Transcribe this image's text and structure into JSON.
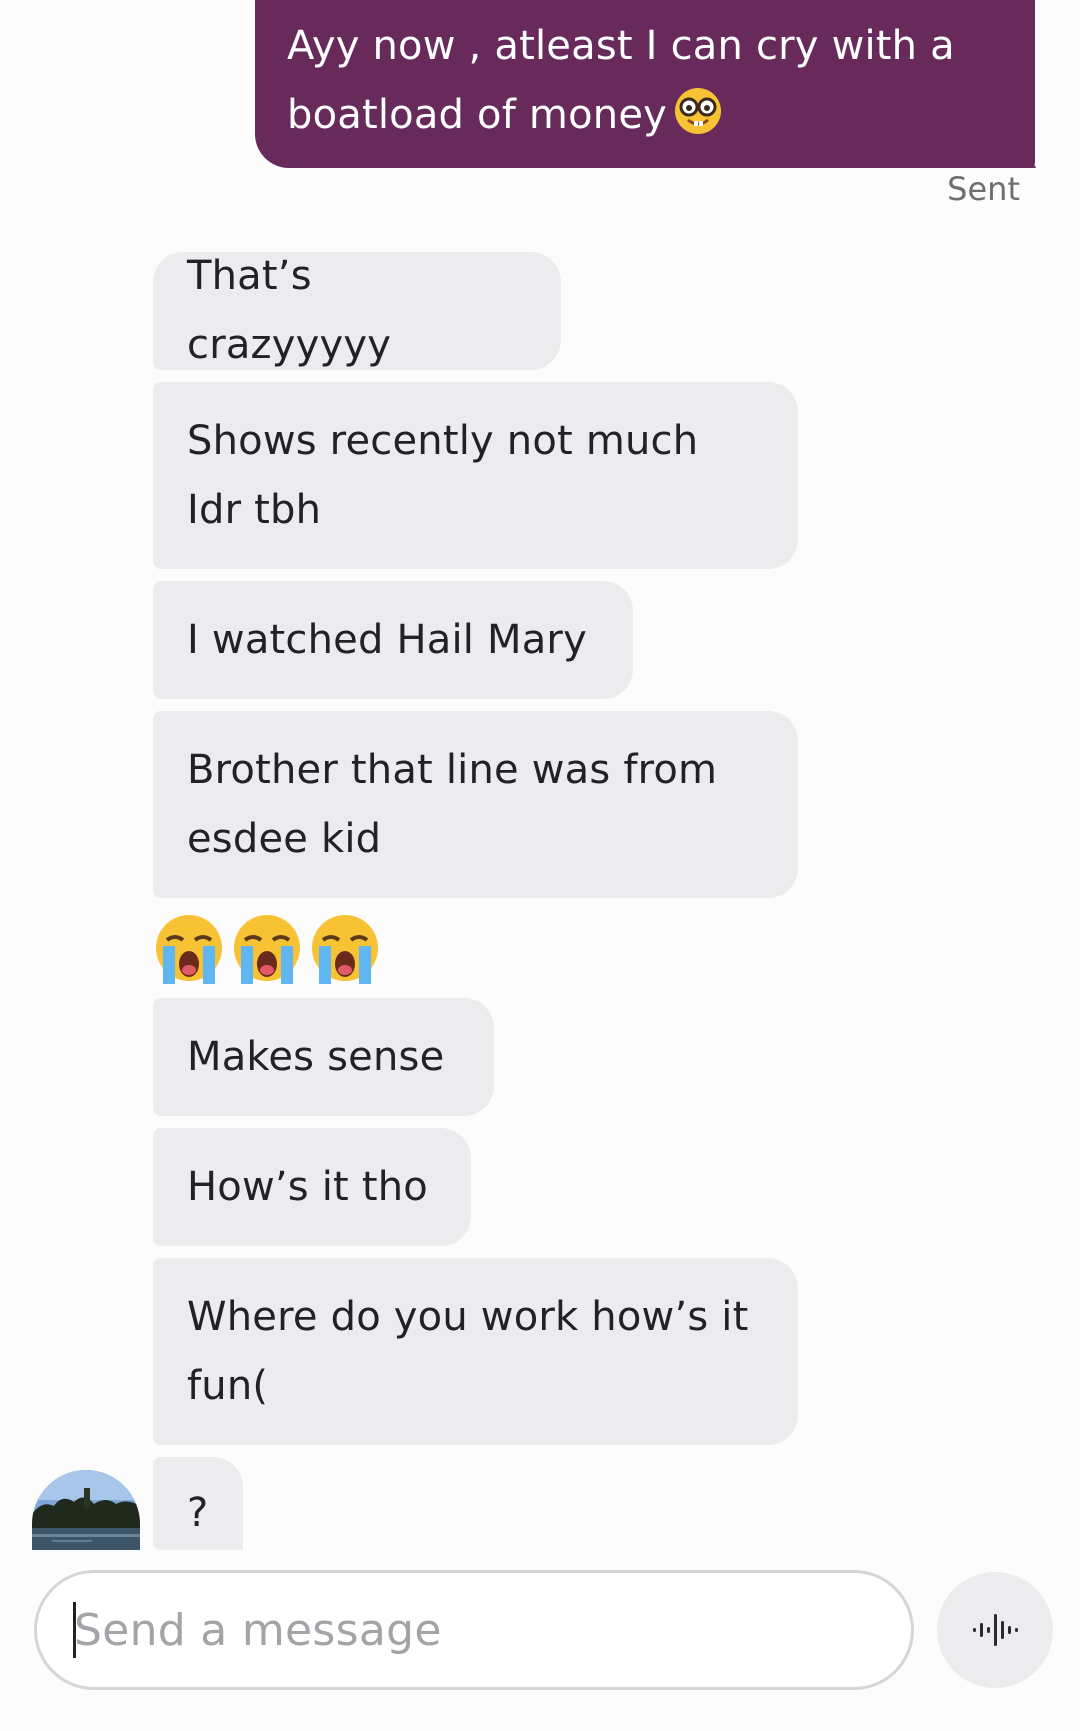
{
  "conversation": {
    "sent_message": {
      "text": "Ayy now , atleast I can cry with a\nboatload of money",
      "emoji": "nerd-face-emoji",
      "status": "Sent",
      "bubble_color": "#672a5b"
    },
    "received_messages": [
      {
        "text": "That’s crazyyyyy"
      },
      {
        "text": "Shows recently not much\nIdr tbh"
      },
      {
        "text": "I watched Hail Mary"
      },
      {
        "text": "Brother that line was from\nesdee kid"
      },
      {
        "emojis": [
          "loudly-crying-face-emoji",
          "loudly-crying-face-emoji",
          "loudly-crying-face-emoji"
        ]
      },
      {
        "text": "Makes sense"
      },
      {
        "text": "How’s it tho"
      },
      {
        "text": "Where do you work how’s it\nfun("
      },
      {
        "text": "?"
      }
    ],
    "received_bubble_color": "#ececee"
  },
  "composer": {
    "placeholder": "Send a message",
    "voice_icon": "voice-waveform-icon"
  }
}
